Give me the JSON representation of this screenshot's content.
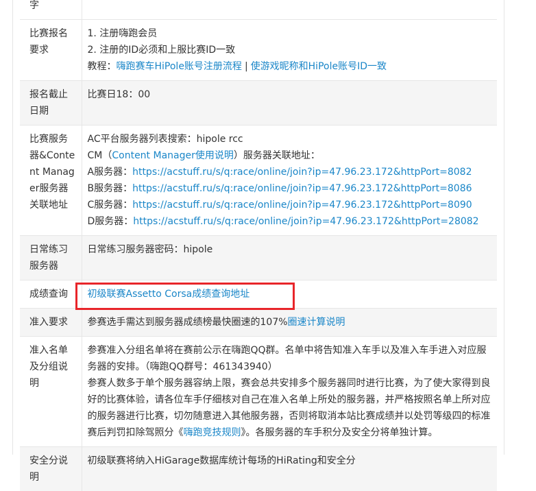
{
  "rows": [
    {
      "label": "字",
      "lines": []
    },
    {
      "label": "比赛报名要求",
      "lines": [
        "1. 注册嗨跑会员",
        "2. 注册的ID必须和上服比赛ID一致"
      ],
      "tutorial_prefix": "教程：",
      "tutorial_link1": "嗨跑赛车HiPole账号注册流程",
      "tutorial_sep": "|",
      "tutorial_link2": "使游戏昵称和HiPole账号ID一致"
    },
    {
      "label": "报名截止日期",
      "value": "比赛日18：00"
    },
    {
      "label": "比赛服务器&Content Manager服务器关联地址",
      "line1": "AC平台服务器列表搜索：hipole rcc",
      "cm_prefix": "CM（",
      "cm_link": "Content Manager使用说明",
      "cm_suffix": "）服务器关联地址：",
      "servers": [
        {
          "name": "A服务器：",
          "url": "https://acstuff.ru/s/q:race/online/join?ip=47.96.23.172&httpPort=8082"
        },
        {
          "name": "B服务器：",
          "url": "https://acstuff.ru/s/q:race/online/join?ip=47.96.23.172&httpPort=8086"
        },
        {
          "name": "C服务器：",
          "url": "https://acstuff.ru/s/q:race/online/join?ip=47.96.23.172&httpPort=8090"
        },
        {
          "name": "D服务器：",
          "url": "https://acstuff.ru/s/q:race/online/join?ip=47.96.23.172&httpPort=28082"
        }
      ]
    },
    {
      "label": "日常练习服务器",
      "value": "日常练习服务器密码：hipole"
    },
    {
      "label": "成绩查询",
      "link": "初级联赛Assetto Corsa成绩查询地址"
    },
    {
      "label": "准入要求",
      "text": "参赛选手需达到服务器成绩榜最快圈速的107%",
      "link": "圈速计算说明"
    },
    {
      "label": "准入名单及分组说明",
      "p1": "参赛准入分组名单将在赛前公示在嗨跑QQ群。名单中将告知准入车手以及准入车手进入对应服务器的安排。（嗨跑QQ群号：461343940）",
      "p2_pre": "参赛人数多于单个服务器容纳上限，赛会总共安排多个服务器同时进行比赛，为了使大家得到良好的比赛体验，请各位车手仔细核对自己在准入名单上所处的服务器，并严格按照名单上所对应的服务器进行比赛，切勿随意进入其他服务器，否则将取消本站比赛成绩并以处罚等级四的标准赛后判罚扣除驾照分《",
      "p2_link": "嗨跑竞技规则",
      "p2_post": "》。各服务器的车手积分及安全分将单独计算。"
    },
    {
      "label": "安全分说明",
      "value": "初级联赛将纳入HiGarage数据库统计每场的HiRating和安全分"
    }
  ]
}
